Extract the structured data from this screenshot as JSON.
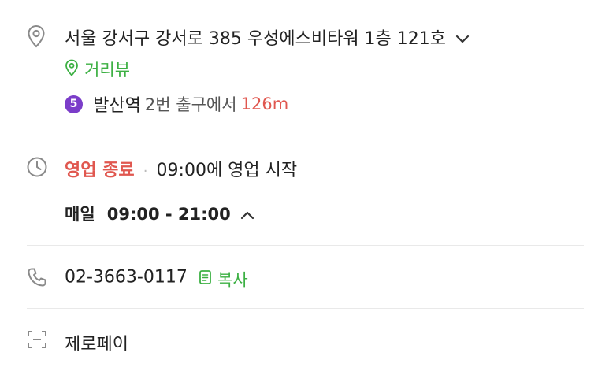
{
  "address": {
    "text": "서울 강서구 강서로 385 우성에스비타워 1층 121호",
    "street_view_label": "거리뷰"
  },
  "subway": {
    "line_number": "5",
    "line_color": "#7b3dc9",
    "station": "발산역",
    "exit_text": "2번 출구에서",
    "distance": "126m"
  },
  "hours": {
    "status": "영업 종료",
    "separator": "·",
    "next_open": "09:00에 영업 시작",
    "schedule_day": "매일",
    "schedule_time": "09:00 - 21:00"
  },
  "phone": {
    "number": "02-3663-0117",
    "copy_label": "복사"
  },
  "payment": {
    "label": "제로페이"
  },
  "colors": {
    "green": "#3cb043",
    "red": "#e0574f",
    "divider": "#e9e9e9"
  }
}
